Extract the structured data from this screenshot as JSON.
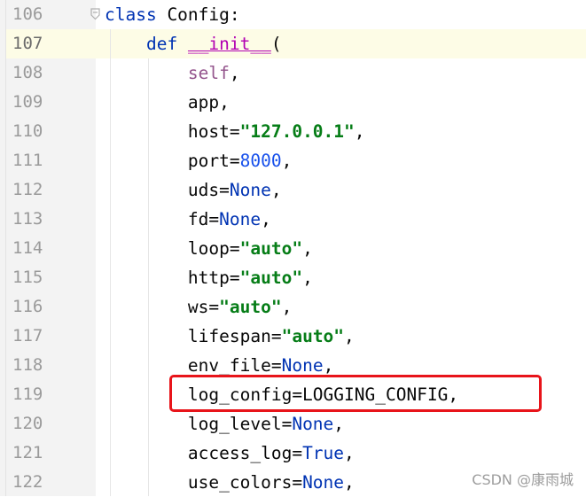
{
  "editor": {
    "lines": [
      {
        "number": "106",
        "parts": [
          [
            "kw",
            "class"
          ],
          [
            "",
            " Config:"
          ]
        ]
      },
      {
        "number": "107",
        "parts": [
          [
            "",
            "    "
          ],
          [
            "kw",
            "def"
          ],
          [
            "",
            " "
          ],
          [
            "fn",
            "__init__"
          ],
          [
            "",
            "("
          ]
        ]
      },
      {
        "number": "108",
        "parts": [
          [
            "",
            "        "
          ],
          [
            "self",
            "self"
          ],
          [
            "",
            ","
          ]
        ]
      },
      {
        "number": "109",
        "parts": [
          [
            "",
            "        app,"
          ]
        ]
      },
      {
        "number": "110",
        "parts": [
          [
            "",
            "        host="
          ],
          [
            "str",
            "\"127.0.0.1\""
          ],
          [
            "",
            ","
          ]
        ]
      },
      {
        "number": "111",
        "parts": [
          [
            "",
            "        port="
          ],
          [
            "num",
            "8000"
          ],
          [
            "",
            ","
          ]
        ]
      },
      {
        "number": "112",
        "parts": [
          [
            "",
            "        uds="
          ],
          [
            "none",
            "None"
          ],
          [
            "",
            ","
          ]
        ]
      },
      {
        "number": "113",
        "parts": [
          [
            "",
            "        fd="
          ],
          [
            "none",
            "None"
          ],
          [
            "",
            ","
          ]
        ]
      },
      {
        "number": "114",
        "parts": [
          [
            "",
            "        loop="
          ],
          [
            "str",
            "\"auto\""
          ],
          [
            "",
            ","
          ]
        ]
      },
      {
        "number": "115",
        "parts": [
          [
            "",
            "        http="
          ],
          [
            "str",
            "\"auto\""
          ],
          [
            "",
            ","
          ]
        ]
      },
      {
        "number": "116",
        "parts": [
          [
            "",
            "        ws="
          ],
          [
            "str",
            "\"auto\""
          ],
          [
            "",
            ","
          ]
        ]
      },
      {
        "number": "117",
        "parts": [
          [
            "",
            "        lifespan="
          ],
          [
            "str",
            "\"auto\""
          ],
          [
            "",
            ","
          ]
        ]
      },
      {
        "number": "118",
        "parts": [
          [
            "",
            "        env_file="
          ],
          [
            "none",
            "None"
          ],
          [
            "",
            ","
          ]
        ]
      },
      {
        "number": "119",
        "parts": [
          [
            "",
            "        log_config=LOGGING_CONFIG,"
          ]
        ]
      },
      {
        "number": "120",
        "parts": [
          [
            "",
            "        log_level="
          ],
          [
            "none",
            "None"
          ],
          [
            "",
            ","
          ]
        ]
      },
      {
        "number": "121",
        "parts": [
          [
            "",
            "        access_log="
          ],
          [
            "none",
            "True"
          ],
          [
            "",
            ","
          ]
        ]
      },
      {
        "number": "122",
        "parts": [
          [
            "",
            "        use_colors="
          ],
          [
            "none",
            "None"
          ],
          [
            "",
            ","
          ]
        ]
      }
    ],
    "current_line": "107",
    "highlighted_line": "119"
  },
  "watermark": "CSDN @康雨城",
  "colors": {
    "keyword": "#0033b3",
    "function_name": "#b200b2",
    "self": "#94558d",
    "string": "#067d17",
    "number": "#1750eb",
    "highlight_box": "#e8141a",
    "current_line_bg": "#fdfce6"
  }
}
